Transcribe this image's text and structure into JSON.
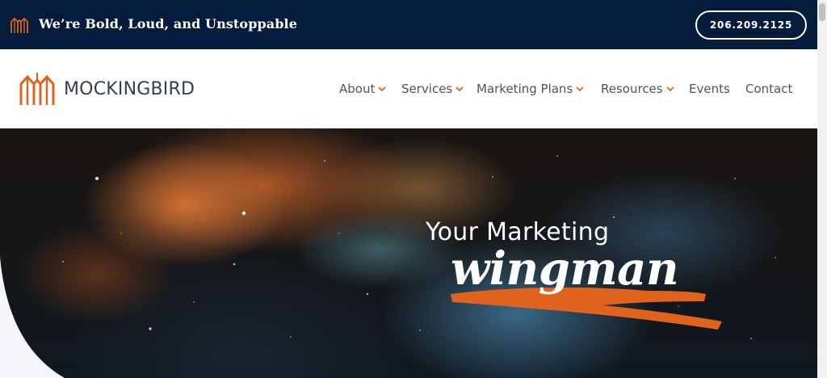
{
  "topbar": {
    "tagline": "We’re Bold, Loud, and Unstoppable",
    "phone": "206.209.2125",
    "logo_icon": "mockingbird-logo-icon"
  },
  "header": {
    "brand_name": "MOCKINGBIRD",
    "brand_icon": "mockingbird-logo-icon",
    "nav": [
      {
        "label": "About",
        "has_dropdown": true
      },
      {
        "label": "Services",
        "has_dropdown": true
      },
      {
        "label": "Marketing Plans",
        "has_dropdown": true
      },
      {
        "label": "Resources",
        "has_dropdown": true
      },
      {
        "label": "Events",
        "has_dropdown": false
      },
      {
        "label": "Contact",
        "has_dropdown": false
      }
    ]
  },
  "hero": {
    "heading": "Your Marketing",
    "script_word": "wingman"
  },
  "colors": {
    "navy": "#051c3d",
    "accent_orange": "#e0631d",
    "nav_text": "#4b5560",
    "white": "#ffffff"
  }
}
